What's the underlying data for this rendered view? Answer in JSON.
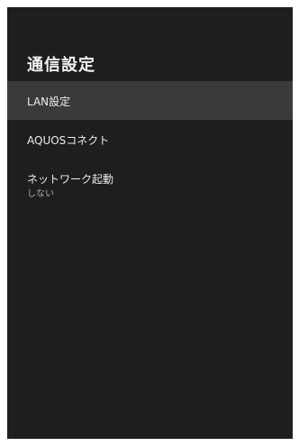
{
  "screen": {
    "title": "通信設定"
  },
  "menu": {
    "items": [
      {
        "label": "LAN設定",
        "selected": true
      },
      {
        "label": "AQUOSコネクト",
        "selected": false
      },
      {
        "label": "ネットワーク起動",
        "value": "しない",
        "selected": false
      }
    ]
  },
  "colors": {
    "background": "#1e1e1e",
    "selected_row": "#3a3a3a",
    "primary_text": "#ececec",
    "secondary_text": "#a9a9a9"
  }
}
